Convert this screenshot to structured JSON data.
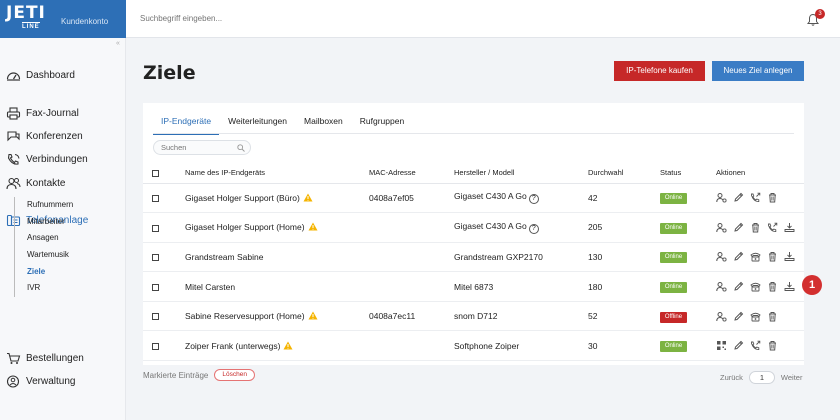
{
  "brand": {
    "logo_text": "JETI",
    "logo_sub": "LINE",
    "account_label": "Kundenkonto"
  },
  "topbar": {
    "search_placeholder": "Suchbegriff eingeben...",
    "notification_count": "3"
  },
  "sidebar": {
    "collapse_glyph": "«",
    "items": [
      {
        "label": "Dashboard",
        "icon": "dashboard-icon"
      },
      {
        "label": "Fax-Journal",
        "icon": "printer-icon"
      },
      {
        "label": "Konferenzen",
        "icon": "conference-icon"
      },
      {
        "label": "Verbindungen",
        "icon": "phone-icon"
      },
      {
        "label": "Kontakte",
        "icon": "contacts-icon"
      },
      {
        "label": "Telefonanlage",
        "icon": "pbx-icon",
        "active": true
      },
      {
        "label": "Bestellungen",
        "icon": "cart-icon"
      },
      {
        "label": "Verwaltung",
        "icon": "admin-icon"
      }
    ],
    "subitems": [
      "Rufnummern",
      "Mitarbeiter",
      "Ansagen",
      "Wartemusik",
      "Ziele",
      "IVR"
    ],
    "selected_subitem": "Ziele"
  },
  "main": {
    "title": "Ziele",
    "buy_button": "IP-Telefone kaufen",
    "new_button": "Neues Ziel anlegen",
    "tabs": [
      "IP-Endgeräte",
      "Weiterleitungen",
      "Mailboxen",
      "Rufgruppen"
    ],
    "active_tab": "IP-Endgeräte",
    "search_placeholder": "Suchen",
    "columns": [
      "Name des IP-Endgeräts",
      "MAC-Adresse",
      "Hersteller / Modell",
      "Durchwahl",
      "Status",
      "Aktionen"
    ],
    "rows": [
      {
        "name": "Gigaset Holger Support (Büro)",
        "warning": true,
        "mac": "0408a7ef05",
        "model": "Gigaset C430 A Go",
        "help": true,
        "ext": "42",
        "status": "Online",
        "actions": [
          "user-settings-icon",
          "edit-icon",
          "call-forward-icon",
          "delete-icon"
        ]
      },
      {
        "name": "Gigaset Holger Support (Home)",
        "warning": true,
        "mac": "",
        "model": "Gigaset C430 A Go",
        "help": true,
        "ext": "205",
        "status": "Online",
        "actions": [
          "user-settings-icon",
          "edit-icon",
          "delete-icon",
          "call-forward-icon",
          "provision-icon"
        ]
      },
      {
        "name": "Grandstream Sabine",
        "warning": false,
        "mac": "",
        "model": "Grandstream GXP2170",
        "help": false,
        "ext": "130",
        "status": "Online",
        "actions": [
          "user-settings-icon",
          "edit-icon",
          "desk-phone-icon",
          "delete-icon",
          "provision-icon"
        ]
      },
      {
        "name": "Mitel Carsten",
        "warning": false,
        "mac": "",
        "model": "Mitel 6873",
        "help": false,
        "ext": "180",
        "status": "Online",
        "actions": [
          "user-settings-icon",
          "edit-icon",
          "desk-phone-icon",
          "delete-icon",
          "provision-icon"
        ]
      },
      {
        "name": "Sabine Reservesupport (Home)",
        "warning": true,
        "mac": "0408a7ec11",
        "model": "snom D712",
        "help": false,
        "ext": "52",
        "status": "Offline",
        "actions": [
          "user-settings-icon",
          "edit-icon",
          "desk-phone-icon",
          "delete-icon"
        ]
      },
      {
        "name": "Zoiper Frank (unterwegs)",
        "warning": true,
        "mac": "",
        "model": "Softphone Zoiper",
        "help": false,
        "ext": "30",
        "status": "Online",
        "actions": [
          "qr-code-icon",
          "edit-icon",
          "call-forward-icon",
          "delete-icon"
        ]
      }
    ],
    "marked_label": "Markierte Einträge",
    "delete_button": "Löschen",
    "pager": {
      "prev": "Zurück",
      "page": "1",
      "next": "Weiter"
    },
    "callout": "1"
  },
  "colors": {
    "brand_blue": "#2d6fb6",
    "danger_red": "#c62828",
    "online_green": "#7cb342"
  }
}
